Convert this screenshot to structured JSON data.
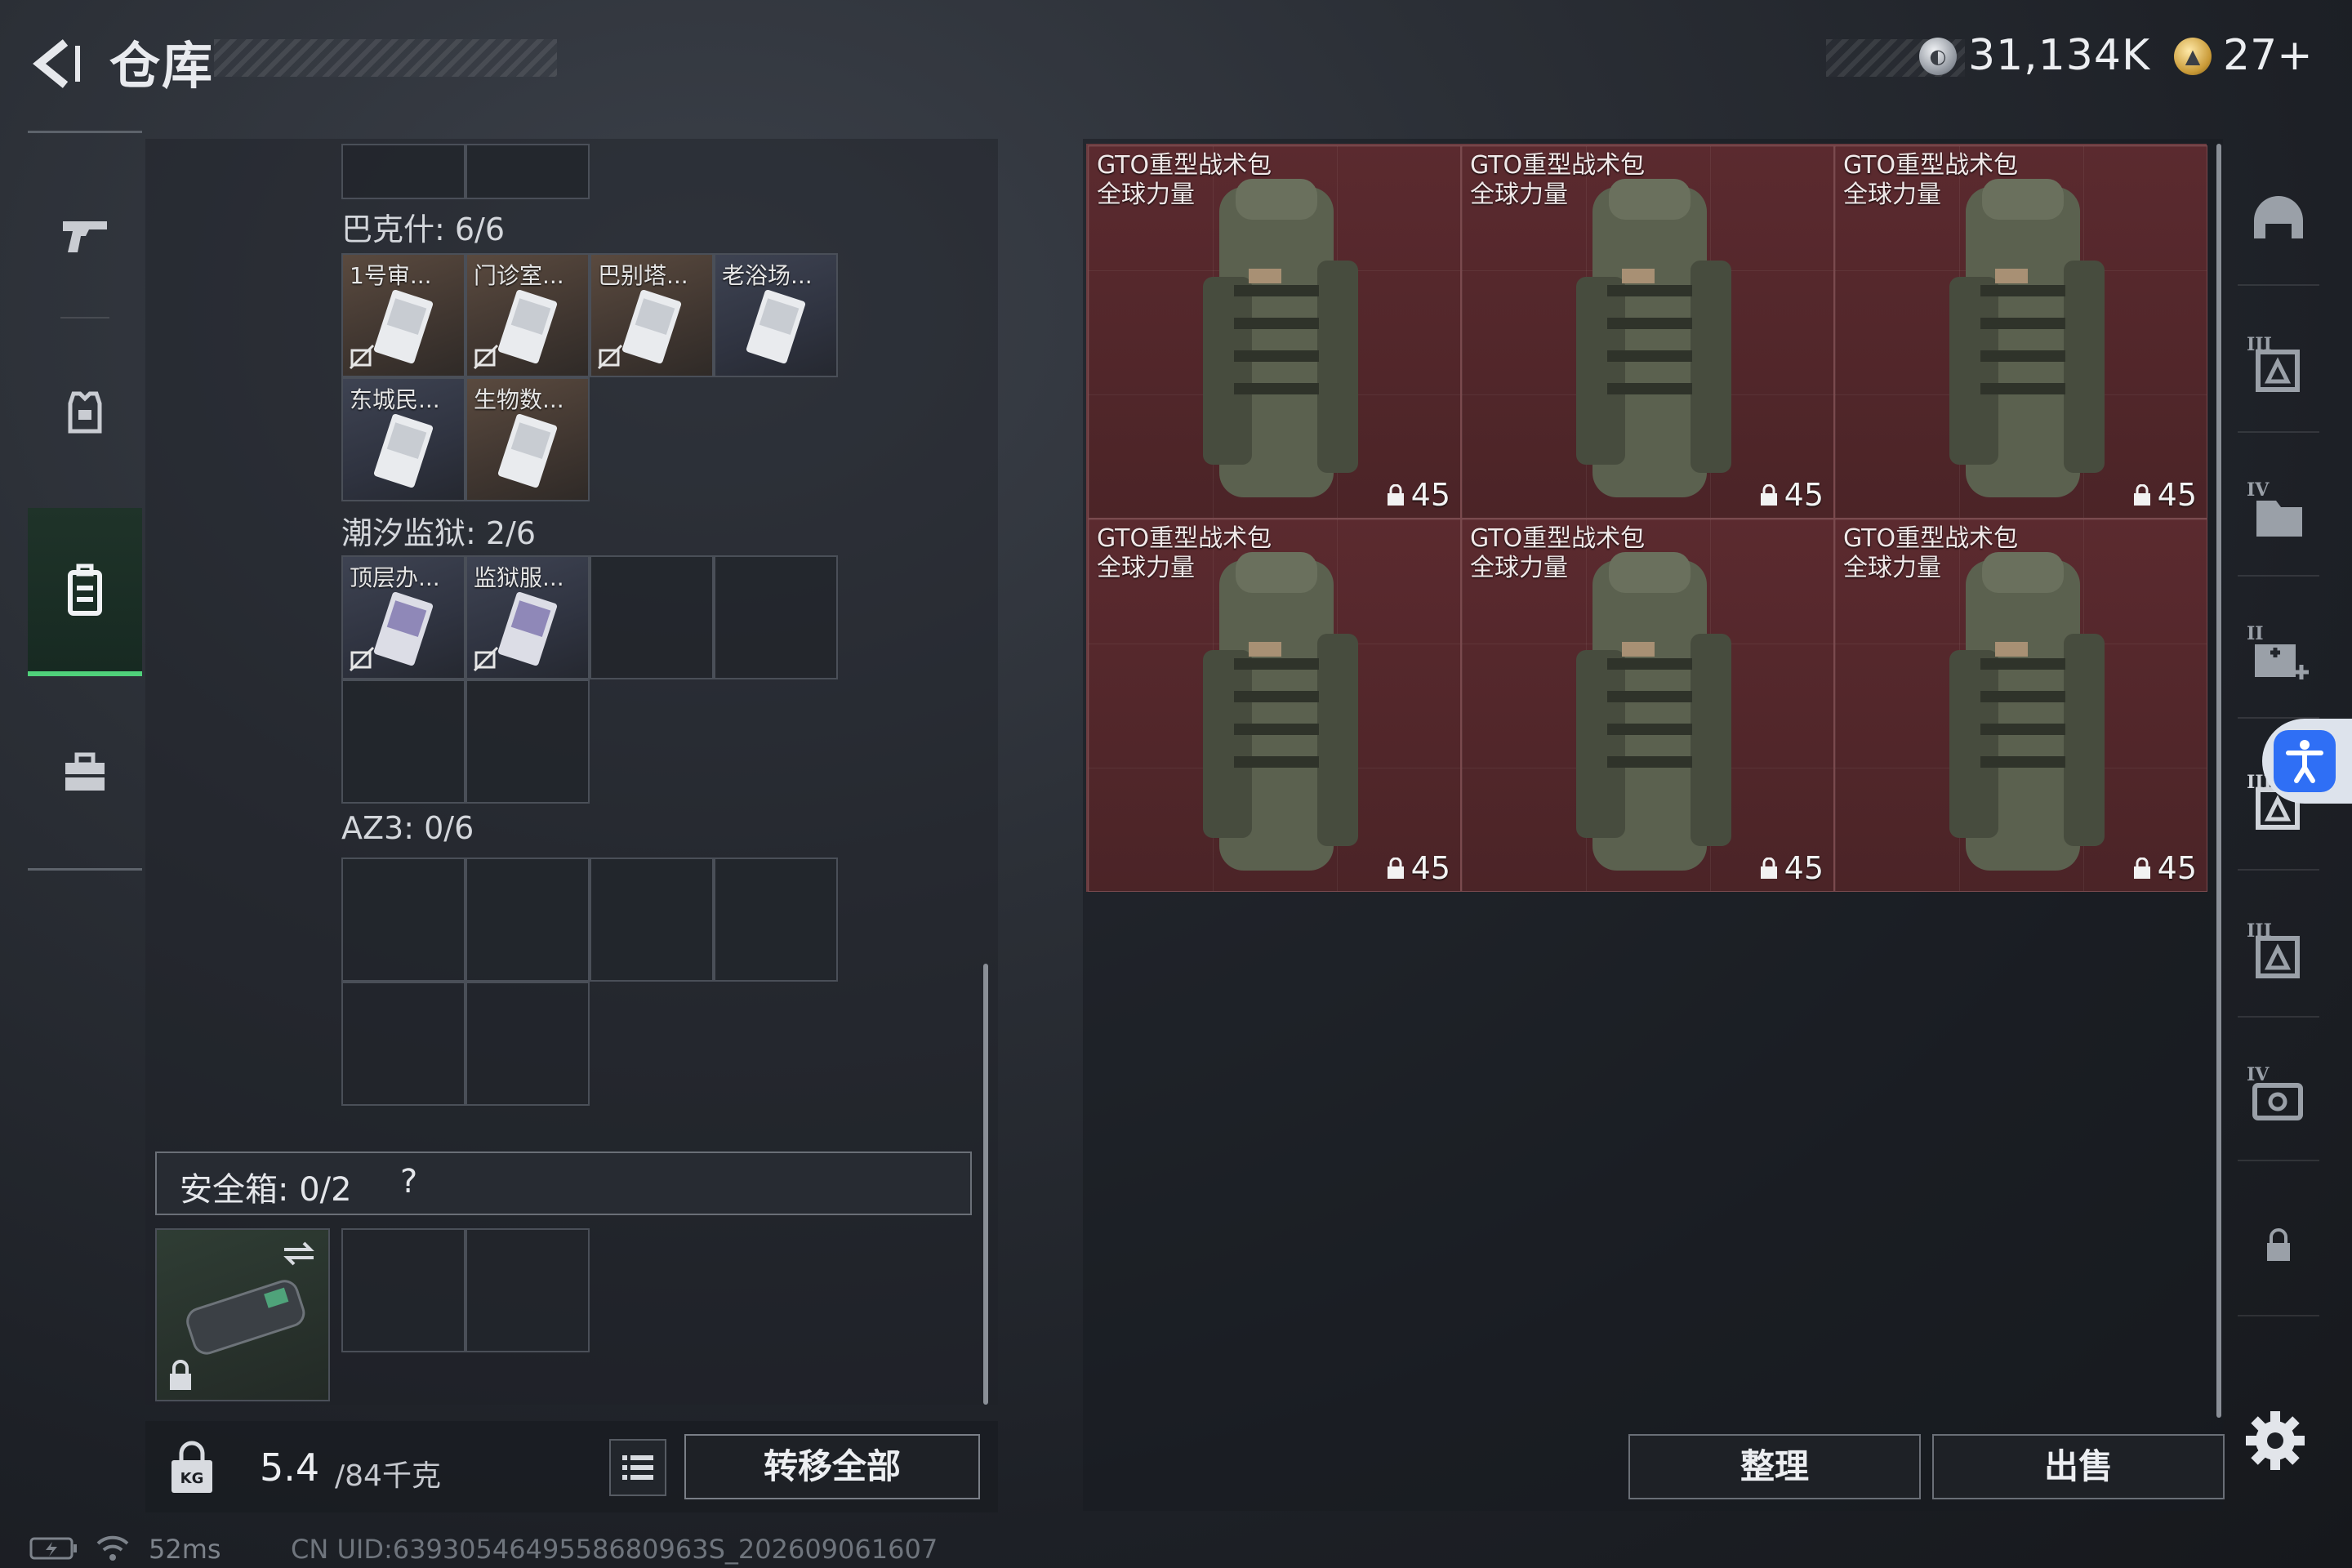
{
  "header": {
    "title": "仓库",
    "money": "31,134K",
    "coupons": "27+"
  },
  "containers": {
    "sections": [
      {
        "label": "巴克什: 6/6"
      },
      {
        "label": "潮汐监狱: 2/6"
      },
      {
        "label": "AZ3: 0/6"
      }
    ],
    "baksh_items": [
      "1号审...",
      "门诊室...",
      "巴别塔...",
      "老浴场...",
      "东城民...",
      "生物数..."
    ],
    "prison_items": [
      "顶层办...",
      "监狱服..."
    ]
  },
  "safe_box": {
    "label": "安全箱: 0/2",
    "help": "?"
  },
  "footer_left": {
    "weight_current": "5.4",
    "weight_max": "/84千克",
    "transfer_all": "转移全部"
  },
  "stash": {
    "items": [
      {
        "name": "GTO重型战术包\n全球力量",
        "count": "45"
      },
      {
        "name": "GTO重型战术包\n全球力量",
        "count": "45"
      },
      {
        "name": "GTO重型战术包\n全球力量",
        "count": "45"
      },
      {
        "name": "GTO重型战术包\n全球力量",
        "count": "45"
      },
      {
        "name": "GTO重型战术包\n全球力量",
        "count": "45"
      },
      {
        "name": "GTO重型战术包\n全球力量",
        "count": "45"
      }
    ],
    "sort_label": "整理",
    "sell_label": "出售"
  },
  "status": {
    "ping": "52ms",
    "uid": "CN UID:6393054649558680963S_202609061607"
  },
  "colors": {
    "accent_green": "#4fd17a",
    "stash_cell": "#5b2a2f",
    "a11y_blue": "#2f6ff5"
  },
  "icons": {
    "nav": [
      "gun-icon",
      "armor-icon",
      "backpack-icon",
      "toolbox-icon"
    ],
    "rail": [
      "helmet-icon",
      "armor-tier3-icon",
      "case-tier4-icon",
      "medkit-tier2-icon",
      "armor-tier3-icon",
      "armor-tier3-icon",
      "backpack-tier4-icon",
      "lock-icon"
    ]
  }
}
